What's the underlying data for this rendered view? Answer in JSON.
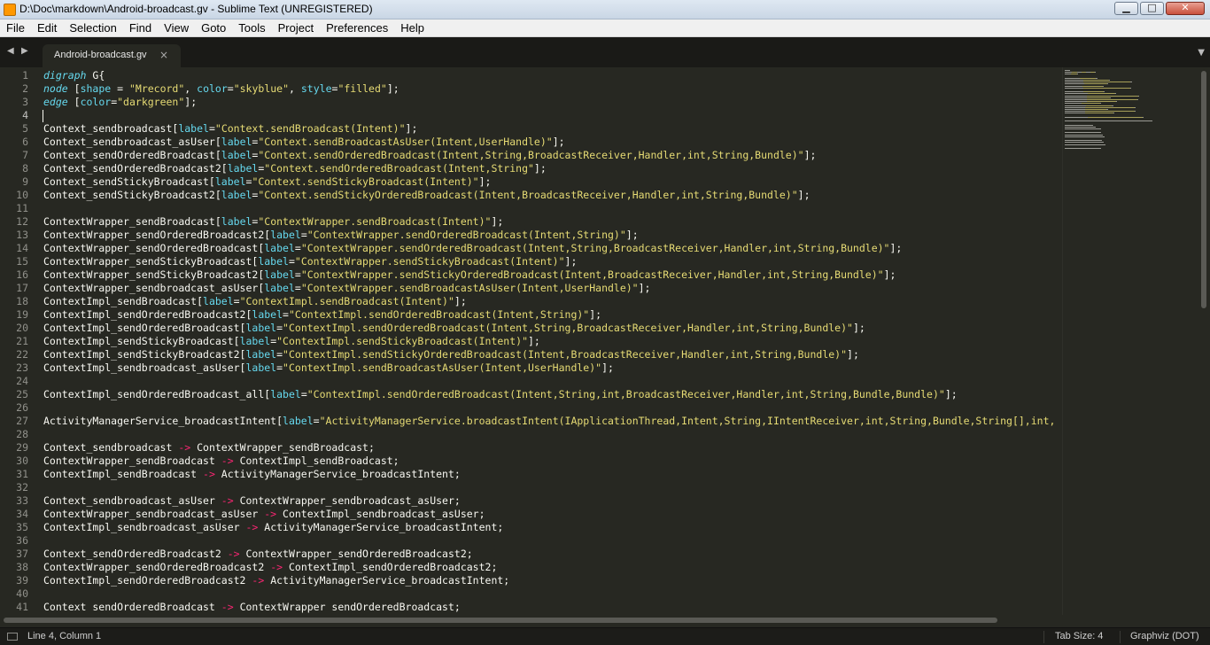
{
  "window": {
    "title": "D:\\Doc\\markdown\\Android-broadcast.gv - Sublime Text (UNREGISTERED)",
    "minimize_glyph": "▁",
    "maximize_glyph": "□",
    "close_glyph": "✕"
  },
  "menu": [
    "File",
    "Edit",
    "Selection",
    "Find",
    "View",
    "Goto",
    "Tools",
    "Project",
    "Preferences",
    "Help"
  ],
  "tabs": {
    "nav_left_glyph": "◀",
    "nav_right_glyph": "▶",
    "active_tab": "Android-broadcast.gv",
    "close_glyph": "×",
    "dropdown_glyph": "▼"
  },
  "editor": {
    "active_line": 4,
    "lines": [
      "digraph G{",
      "node [shape = \"Mrecord\", color=\"skyblue\", style=\"filled\"];",
      "edge [color=\"darkgreen\"];",
      "",
      "Context_sendbroadcast[label=\"Context.sendBroadcast(Intent)\"];",
      "Context_sendbroadcast_asUser[label=\"Context.sendBroadcastAsUser(Intent,UserHandle)\"];",
      "Context_sendOrderedBroadcast[label=\"Context.sendOrderedBroadcast(Intent,String,BroadcastReceiver,Handler,int,String,Bundle)\"];",
      "Context_sendOrderedBroadcast2[label=\"Context.sendOrderedBroadcast(Intent,String\"];",
      "Context_sendStickyBroadcast[label=\"Context.sendStickyBroadcast(Intent)\"];",
      "Context_sendStickyBroadcast2[label=\"Context.sendStickyOrderedBroadcast(Intent,BroadcastReceiver,Handler,int,String,Bundle)\"];",
      "",
      "ContextWrapper_sendBroadcast[label=\"ContextWrapper.sendBroadcast(Intent)\"];",
      "ContextWrapper_sendOrderedBroadcast2[label=\"ContextWrapper.sendOrderedBroadcast(Intent,String)\"];",
      "ContextWrapper_sendOrderedBroadcast[label=\"ContextWrapper.sendOrderedBroadcast(Intent,String,BroadcastReceiver,Handler,int,String,Bundle)\"];",
      "ContextWrapper_sendStickyBroadcast[label=\"ContextWrapper.sendStickyBroadcast(Intent)\"];",
      "ContextWrapper_sendStickyBroadcast2[label=\"ContextWrapper.sendStickyOrderedBroadcast(Intent,BroadcastReceiver,Handler,int,String,Bundle)\"];",
      "ContextWrapper_sendbroadcast_asUser[label=\"ContextWrapper.sendBroadcastAsUser(Intent,UserHandle)\"];",
      "ContextImpl_sendBroadcast[label=\"ContextImpl.sendBroadcast(Intent)\"];",
      "ContextImpl_sendOrderedBroadcast2[label=\"ContextImpl.sendOrderedBroadcast(Intent,String)\"];",
      "ContextImpl_sendOrderedBroadcast[label=\"ContextImpl.sendOrderedBroadcast(Intent,String,BroadcastReceiver,Handler,int,String,Bundle)\"];",
      "ContextImpl_sendStickyBroadcast[label=\"ContextImpl.sendStickyBroadcast(Intent)\"];",
      "ContextImpl_sendStickyBroadcast2[label=\"ContextImpl.sendStickyOrderedBroadcast(Intent,BroadcastReceiver,Handler,int,String,Bundle)\"];",
      "ContextImpl_sendbroadcast_asUser[label=\"ContextImpl.sendBroadcastAsUser(Intent,UserHandle)\"];",
      "",
      "ContextImpl_sendOrderedBroadcast_all[label=\"ContextImpl.sendOrderedBroadcast(Intent,String,int,BroadcastReceiver,Handler,int,String,Bundle,Bundle)\"];",
      "",
      "ActivityManagerService_broadcastIntent[label=\"ActivityManagerService.broadcastIntent(IApplicationThread,Intent,String,IIntentReceiver,int,String,Bundle,String[],int,",
      "",
      "Context_sendbroadcast -> ContextWrapper_sendBroadcast;",
      "ContextWrapper_sendBroadcast -> ContextImpl_sendBroadcast;",
      "ContextImpl_sendBroadcast -> ActivityManagerService_broadcastIntent;",
      "",
      "Context_sendbroadcast_asUser -> ContextWrapper_sendbroadcast_asUser;",
      "ContextWrapper_sendbroadcast_asUser -> ContextImpl_sendbroadcast_asUser;",
      "ContextImpl_sendbroadcast_asUser -> ActivityManagerService_broadcastIntent;",
      "",
      "Context_sendOrderedBroadcast2 -> ContextWrapper_sendOrderedBroadcast2;",
      "ContextWrapper_sendOrderedBroadcast2 -> ContextImpl_sendOrderedBroadcast2;",
      "ContextImpl_sendOrderedBroadcast2 -> ActivityManagerService_broadcastIntent;",
      "",
      "Context sendOrderedBroadcast -> ContextWrapper sendOrderedBroadcast;"
    ]
  },
  "statusbar": {
    "position": "Line 4, Column 1",
    "tab_size": "Tab Size: 4",
    "syntax": "Graphviz (DOT)"
  },
  "colors": {
    "background": "#272822",
    "foreground": "#f8f8f2",
    "keyword": "#66d9ef",
    "string": "#e6db74",
    "operator": "#f92672",
    "line_number": "#90908a"
  }
}
